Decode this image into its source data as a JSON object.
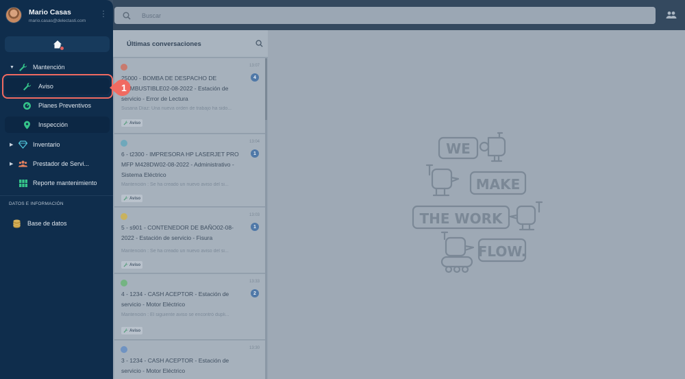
{
  "profile": {
    "name": "Mario Casas",
    "email": "mario.casas@delectasti.com"
  },
  "search": {
    "placeholder": "Buscar"
  },
  "sidebar": {
    "mantencion": "Mantención",
    "aviso": "Aviso",
    "planes": "Planes Preventivos",
    "inspeccion": "Inspección",
    "inventario": "Inventario",
    "prestador": "Prestador de Servi...",
    "reporte": "Reporte mantenimiento",
    "section_title": "DATOS E INFORMACIÓN",
    "base_datos": "Base de datos"
  },
  "callout": {
    "number": "1"
  },
  "conversations": {
    "title": "Últimas conversaciones",
    "items": [
      {
        "text": "25000 - BOMBA DE DESPACHO DE COMBUSTIBLE02-08-2022 - Estación de servicio - Error de Lectura",
        "time": "13:07",
        "badge": "4",
        "preview": "Susana Díaz: Una nueva orden de trabajo ha sido...",
        "tag": "Aviso",
        "dot_color": "#c87a6e"
      },
      {
        "text": "6 - t2300 - IMPRESORA HP LASERJET PRO MFP M428DW02-08-2022 - Administrativo - Sistema Eléctrico",
        "time": "13:04",
        "badge": "1",
        "preview": "Mantención : Se ha creado un nuevo aviso del si...",
        "tag": "Aviso",
        "dot_color": "#6fa8bb"
      },
      {
        "text": "5 - s901 - CONTENEDOR DE BAÑO02-08-2022 - Estación de servicio - Fisura",
        "time": "13:03",
        "badge": "1",
        "preview": "Mantención : Se ha creado un nuevo aviso del si...",
        "tag": "Aviso",
        "dot_color": "#c9b25e"
      },
      {
        "text": "4 - 1234 - CASH ACEPTOR - Estación de servicio - Motor Eléctrico",
        "time": "13:33",
        "badge": "2",
        "preview": "Mantención : El siguiente aviso se encontró dupli...",
        "tag": "Aviso",
        "dot_color": "#74b482"
      },
      {
        "text": "3 - 1234 - CASH ACEPTOR - Estación de servicio - Motor Eléctrico",
        "time": "13:30",
        "badge": "",
        "preview": "",
        "tag": "",
        "dot_color": "#6f93c2"
      }
    ]
  },
  "illustration": {
    "word1": "WE",
    "word2": "MAKE",
    "word3": "THE WORK",
    "word4": "FLOW."
  },
  "colors": {
    "sidebar": "#0f2d4c",
    "accent_green": "#35c48a",
    "callout_red": "#f06a61"
  }
}
